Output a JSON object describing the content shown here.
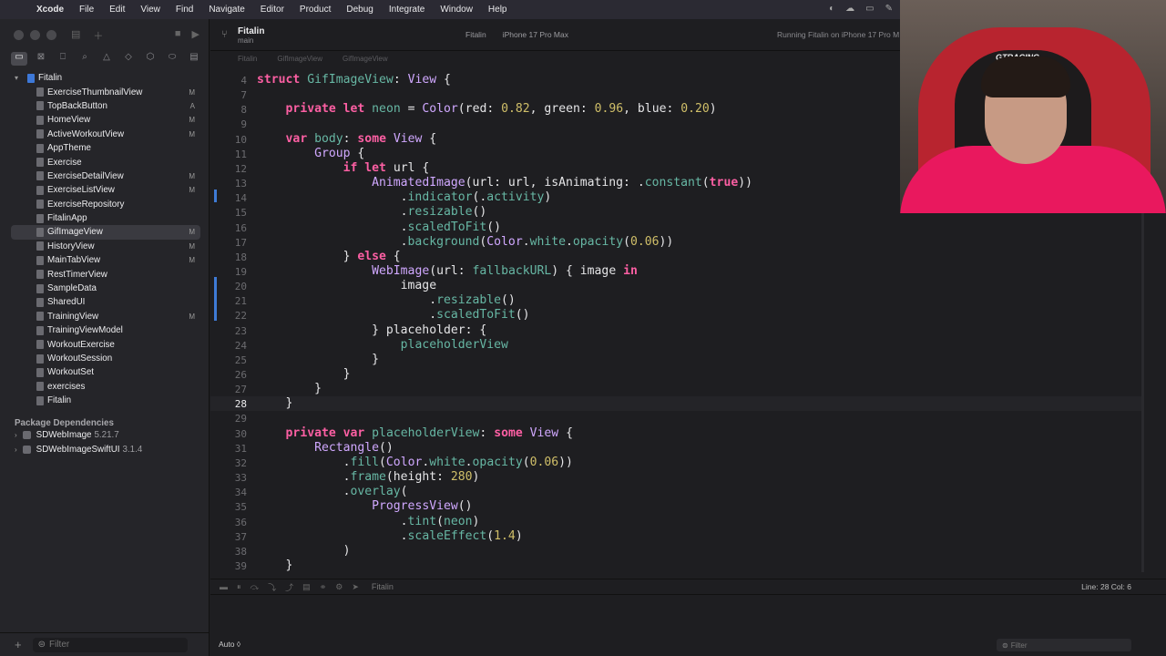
{
  "menubar": {
    "app": "Xcode",
    "items": [
      "File",
      "Edit",
      "View",
      "Find",
      "Navigate",
      "Editor",
      "Product",
      "Debug",
      "Integrate",
      "Window",
      "Help"
    ]
  },
  "navigator": {
    "root": "Fitalin",
    "files": [
      {
        "name": "ExerciseThumbnailView",
        "badge": "M"
      },
      {
        "name": "TopBackButton",
        "badge": "A"
      },
      {
        "name": "HomeView",
        "badge": "M"
      },
      {
        "name": "ActiveWorkoutView",
        "badge": "M"
      },
      {
        "name": "AppTheme",
        "badge": ""
      },
      {
        "name": "Exercise",
        "badge": ""
      },
      {
        "name": "ExerciseDetailView",
        "badge": "M"
      },
      {
        "name": "ExerciseListView",
        "badge": "M"
      },
      {
        "name": "ExerciseRepository",
        "badge": ""
      },
      {
        "name": "FitalinApp",
        "badge": ""
      },
      {
        "name": "GifImageView",
        "badge": "M"
      },
      {
        "name": "HistoryView",
        "badge": "M"
      },
      {
        "name": "MainTabView",
        "badge": "M"
      },
      {
        "name": "RestTimerView",
        "badge": ""
      },
      {
        "name": "SampleData",
        "badge": ""
      },
      {
        "name": "SharedUI",
        "badge": ""
      },
      {
        "name": "TrainingView",
        "badge": "M"
      },
      {
        "name": "TrainingViewModel",
        "badge": ""
      },
      {
        "name": "WorkoutExercise",
        "badge": ""
      },
      {
        "name": "WorkoutSession",
        "badge": ""
      },
      {
        "name": "WorkoutSet",
        "badge": ""
      },
      {
        "name": "exercises",
        "badge": ""
      },
      {
        "name": "Fitalin",
        "badge": ""
      }
    ],
    "selected_index": 10,
    "packages_header": "Package Dependencies",
    "packages": [
      {
        "name": "SDWebImage",
        "version": "5.21.7"
      },
      {
        "name": "SDWebImageSwiftUI",
        "version": "3.1.4"
      }
    ],
    "filter_placeholder": "Filter"
  },
  "editor": {
    "project_title": "Fitalin",
    "branch": "main",
    "scheme": "Fitalin",
    "device": "iPhone 17 Pro Max",
    "run_status": "Running Fitalin on iPhone 17 Pro M",
    "jump": [
      "Fitalin",
      "GifImageView",
      "GifImageView"
    ],
    "current_line": 28,
    "lines": [
      {
        "n": 4,
        "text": "struct GifImageView: View {"
      },
      {
        "n": 7,
        "text": ""
      },
      {
        "n": 8,
        "text": "    private let neon = Color(red: 0.82, green: 0.96, blue: 0.20)"
      },
      {
        "n": 9,
        "text": ""
      },
      {
        "n": 10,
        "text": "    var body: some View {"
      },
      {
        "n": 11,
        "text": "        Group {"
      },
      {
        "n": 12,
        "text": "            if let url {"
      },
      {
        "n": 13,
        "text": "                AnimatedImage(url: url, isAnimating: .constant(true))"
      },
      {
        "n": 14,
        "text": "                    .indicator(.activity)"
      },
      {
        "n": 15,
        "text": "                    .resizable()"
      },
      {
        "n": 16,
        "text": "                    .scaledToFit()"
      },
      {
        "n": 17,
        "text": "                    .background(Color.white.opacity(0.06))"
      },
      {
        "n": 18,
        "text": "            } else {"
      },
      {
        "n": 19,
        "text": "                WebImage(url: fallbackURL) { image in"
      },
      {
        "n": 20,
        "text": "                    image"
      },
      {
        "n": 21,
        "text": "                        .resizable()"
      },
      {
        "n": 22,
        "text": "                        .scaledToFit()"
      },
      {
        "n": 23,
        "text": "                } placeholder: {"
      },
      {
        "n": 24,
        "text": "                    placeholderView"
      },
      {
        "n": 25,
        "text": "                }"
      },
      {
        "n": 26,
        "text": "            }"
      },
      {
        "n": 27,
        "text": "        }"
      },
      {
        "n": 28,
        "text": "    }"
      },
      {
        "n": 29,
        "text": ""
      },
      {
        "n": 30,
        "text": "    private var placeholderView: some View {"
      },
      {
        "n": 31,
        "text": "        Rectangle()"
      },
      {
        "n": 32,
        "text": "            .fill(Color.white.opacity(0.06))"
      },
      {
        "n": 33,
        "text": "            .frame(height: 280)"
      },
      {
        "n": 34,
        "text": "            .overlay("
      },
      {
        "n": 35,
        "text": "                ProgressView()"
      },
      {
        "n": 36,
        "text": "                    .tint(neon)"
      },
      {
        "n": 37,
        "text": "                    .scaleEffect(1.4)"
      },
      {
        "n": 38,
        "text": "            )"
      },
      {
        "n": 39,
        "text": "    }"
      }
    ]
  },
  "debug": {
    "target": "Fitalin",
    "position": "Line: 28  Col: 6",
    "console_mode": "Auto ◊",
    "filter_placeholder": "Filter"
  },
  "webcam": {
    "chair_logo": "GTRACING"
  },
  "colors": {
    "keyword": "#fc5fa3",
    "type": "#d0a8ff",
    "identifier": "#67b7a4",
    "number": "#d0bf69",
    "selection": "#3a3a40",
    "accent": "#3e7bd6"
  }
}
